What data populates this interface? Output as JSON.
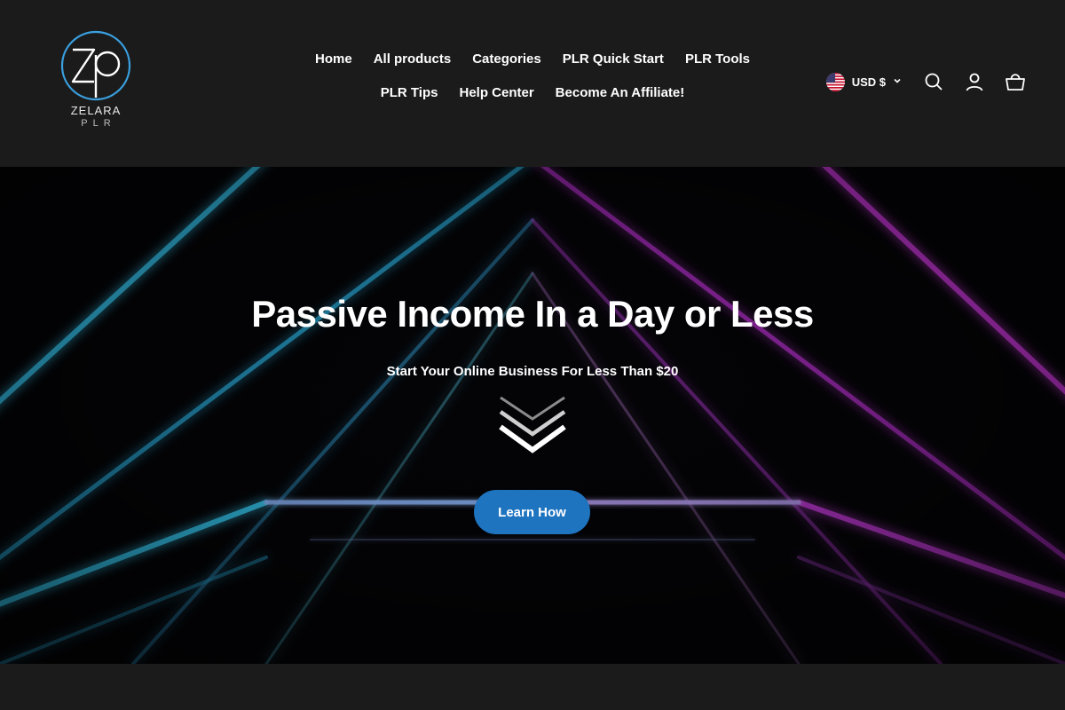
{
  "brand": {
    "name": "ZELARA",
    "sub": "PLR",
    "accent": "#3aa0e0"
  },
  "nav": {
    "items": [
      {
        "label": "Home"
      },
      {
        "label": "All products"
      },
      {
        "label": "Categories"
      },
      {
        "label": "PLR Quick Start"
      },
      {
        "label": "PLR Tools"
      },
      {
        "label": "PLR Tips"
      },
      {
        "label": "Help Center"
      },
      {
        "label": "Become An Affiliate!"
      }
    ]
  },
  "header_tools": {
    "currency": "USD $",
    "flag_icon": "us-flag-icon",
    "icons": [
      "chevron-down-icon",
      "search-icon",
      "account-icon",
      "cart-icon"
    ]
  },
  "hero": {
    "title": "Passive Income In a Day or Less",
    "subtitle": "Start Your Online Business For Less Than $20",
    "cta_label": "Learn How",
    "cta_color": "#1f74c0",
    "decor_icon": "triple-chevron-down-icon",
    "neon_colors": [
      "#35c6f0",
      "#d03ae0",
      "#8fb8ff"
    ]
  }
}
